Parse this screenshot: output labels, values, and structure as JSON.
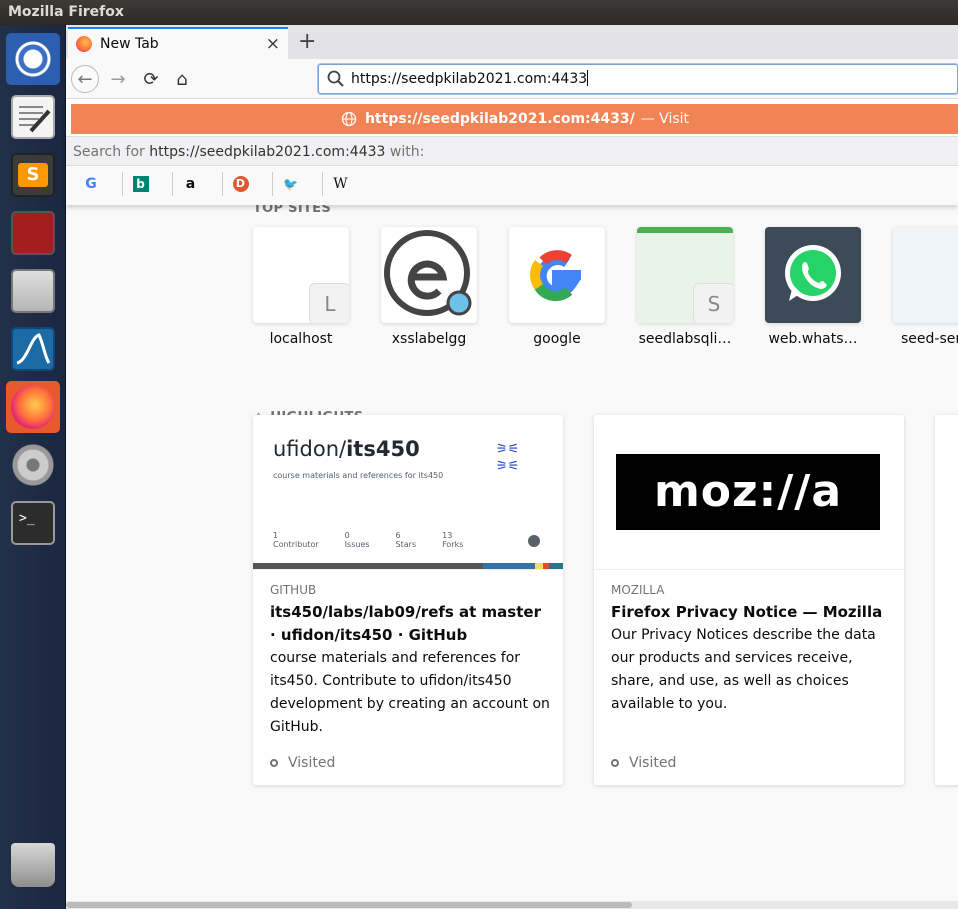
{
  "window": {
    "title": "Mozilla Firefox"
  },
  "launcher": {
    "items": [
      "dash-home",
      "text-editor",
      "sublime-text",
      "system-monitor",
      "file-manager",
      "wireshark",
      "firefox",
      "system-settings",
      "terminal",
      "trash"
    ]
  },
  "tabs": [
    {
      "label": "New Tab",
      "close": "×"
    }
  ],
  "new_tab_glyph": "+",
  "nav": {
    "back": "←",
    "forward": "→",
    "reload": "⟳",
    "home": "⌂"
  },
  "urlbar": {
    "value": "https://seedpkilab2021.com:4433"
  },
  "dropdown": {
    "visit_url": "https://seedpkilab2021.com:4433/",
    "visit_suffix": "— Visit",
    "search_prefix": "Search for",
    "search_query": "https://seedpkilab2021.com:4433",
    "search_suffix": "with:",
    "engines": [
      {
        "name": "google",
        "glyph": "G",
        "color": "#4285f4"
      },
      {
        "name": "bing",
        "glyph": "b",
        "color": "#008373"
      },
      {
        "name": "amazon",
        "glyph": "a",
        "color": "#111111"
      },
      {
        "name": "duckduckgo",
        "glyph": "D",
        "color": "#de5833"
      },
      {
        "name": "twitter",
        "glyph": "🐦",
        "color": "#1da1f2"
      },
      {
        "name": "wikipedia",
        "glyph": "W",
        "color": "#111111"
      }
    ]
  },
  "top_sites": {
    "heading": "TOP SITES",
    "sites": [
      {
        "label": "localhost",
        "badge": "L"
      },
      {
        "label": "xsslabelgg",
        "badge": ""
      },
      {
        "label": "google",
        "badge": ""
      },
      {
        "label": "seedlabsqli…",
        "badge": "S"
      },
      {
        "label": "web.whats…",
        "badge": ""
      },
      {
        "label": "seed-ser",
        "badge": ""
      }
    ]
  },
  "highlights": {
    "heading": "HIGHLIGHTS",
    "cards": [
      {
        "source": "GITHUB",
        "title": "its450/labs/lab09/refs at master · ufidon/its450 · GitHub",
        "description": "course materials and references for its450. Contribute to ufidon/its450 development by creating an account on GitHub.",
        "status": "Visited",
        "preview": {
          "repo_owner": "ufidon/",
          "repo_name": "its450",
          "repo_desc": "course materials and references for its450",
          "stats": [
            {
              "value": "1",
              "label": "Contributor"
            },
            {
              "value": "0",
              "label": "Issues"
            },
            {
              "value": "6",
              "label": "Stars"
            },
            {
              "value": "13",
              "label": "Forks"
            }
          ]
        }
      },
      {
        "source": "MOZILLA",
        "title": "Firefox Privacy Notice — Mozilla",
        "description": "Our Privacy Notices describe the data our products and services receive, share, and use, as well as choices available to you.",
        "status": "Visited",
        "preview": {
          "logo_text": "moz://a"
        }
      }
    ]
  }
}
